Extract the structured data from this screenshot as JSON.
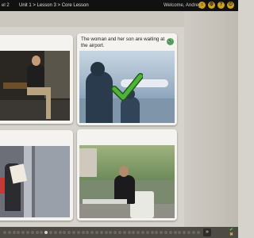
{
  "topbar": {
    "level_text": "el 2",
    "breadcrumb": "Unit 1 > Lesson 3 > Core Lesson",
    "welcome": "Welcome, Andrey",
    "icons": [
      "home-icon",
      "settings-icon",
      "help-icon",
      "exit-icon"
    ],
    "icon_glyphs": [
      "⌂",
      "⚙",
      "?",
      "⏻"
    ]
  },
  "cards": [
    {
      "caption": "",
      "image": "man-on-bench-photo"
    },
    {
      "caption": "The woman and her son are waiting at the airport.",
      "image": "man-and-boy-airport-photo",
      "audio_glyph": "🔊",
      "correct_mark": true
    },
    {
      "caption": "",
      "image": "woman-reading-paper-photo"
    },
    {
      "caption": "",
      "image": "woman-at-cafe-photo"
    }
  ],
  "bottombar": {
    "next_glyph": "»",
    "check_glyph": "✔",
    "cancel_glyph": "✖",
    "page_dots": 43,
    "active_dot": 9
  },
  "colors": {
    "topbar_bg": "#111111",
    "accent_gold": "#caa01e",
    "check_green": "#4fb33a",
    "audio_green": "#4ca04a"
  }
}
